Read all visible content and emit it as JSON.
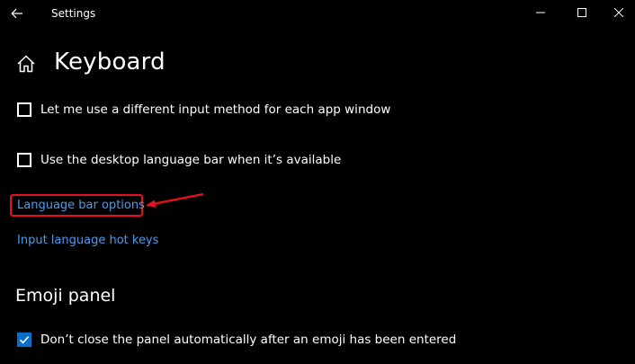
{
  "window": {
    "title": "Settings"
  },
  "header": {
    "title": "Keyboard"
  },
  "options": [
    {
      "label": "Let me use a different input method for each app window",
      "checked": false
    },
    {
      "label": "Use the desktop language bar when it’s available",
      "checked": false
    }
  ],
  "links": {
    "language_bar_options": "Language bar options",
    "input_language_hot_keys": "Input language hot keys"
  },
  "emoji": {
    "heading": "Emoji panel",
    "option_label": "Don’t close the panel automatically after an emoji has been entered",
    "option_checked": true
  },
  "icons": {
    "back": "back-arrow-icon",
    "minimize": "minimize-icon",
    "maximize": "maximize-icon",
    "close": "close-icon",
    "home": "home-icon",
    "checkmark": "checkmark-icon"
  },
  "colors": {
    "background": "#000000",
    "link": "#4a9cef",
    "accent": "#0b6fc9",
    "annotation": "#e8101c"
  }
}
